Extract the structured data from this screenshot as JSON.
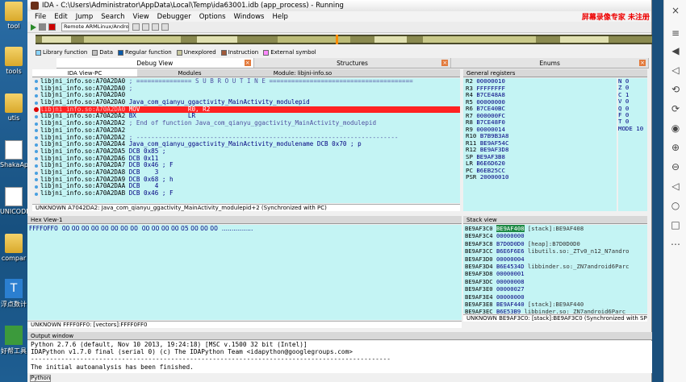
{
  "window": {
    "title": "IDA - C:\\Users\\Administrator\\AppData\\Local\\Temp\\ida63001.idb (app_process) - Running",
    "recorder_badge": "屏幕录像专家 未注册"
  },
  "menu": [
    "File",
    "Edit",
    "Jump",
    "Search",
    "View",
    "Debugger",
    "Options",
    "Windows",
    "Help"
  ],
  "toolbar": {
    "debugger_select": "Remote ARMLinux/Android debugger"
  },
  "legend": [
    {
      "label": "Library function",
      "color": "#8ad4ff"
    },
    {
      "label": "Data",
      "color": "#c0c0c0"
    },
    {
      "label": "Regular function",
      "color": "#0a5aa8"
    },
    {
      "label": "Unexplored",
      "color": "#c8c8a0"
    },
    {
      "label": "Instruction",
      "color": "#a05a3a"
    },
    {
      "label": "External symbol",
      "color": "#ff88ff"
    }
  ],
  "top_tabs": [
    "Debug View",
    "Structures",
    "Enums"
  ],
  "debug_view": {
    "subtabs": [
      "IDA View-PC",
      "Modules",
      "Module: libjni-info.so"
    ],
    "lines": [
      {
        "addr": "libjni_info.so:A70A2DA0",
        "text": " ; =============== S U B R O U T I N E ======================================="
      },
      {
        "addr": "libjni_info.so:A70A2DA0",
        "text": " ;"
      },
      {
        "addr": "libjni_info.so:A70A2DA0",
        "text": ""
      },
      {
        "addr": "libjni_info.so:A70A2DA0",
        "text": " Java_com_qianyu_ggactivity_MainActivity_modulepid"
      },
      {
        "addr": "libjni_info.so:A70A2DA0",
        "text": " MOV             R0, R2",
        "highlight": true
      },
      {
        "addr": "libjni_info.so:A70A2DA2",
        "text": " BX              LR"
      },
      {
        "addr": "libjni_info.so:A70A2DA2",
        "text": " ; End of function Java_com_qianyu_ggactivity_MainActivity_modulepid"
      },
      {
        "addr": "libjni_info.so:A70A2DA2",
        "text": ""
      },
      {
        "addr": "libjni_info.so:A70A2DA2",
        "text": " ; -----------------------------------------------------------------------"
      },
      {
        "addr": "libjni_info.so:A70A2DA4",
        "text": " Java_com_qianyu_ggactivity_MainActivity_modulename DCB 0x70 ; p"
      },
      {
        "addr": "libjni_info.so:A70A2DA5",
        "text": " DCB 0x85 ;"
      },
      {
        "addr": "libjni_info.so:A70A2DA6",
        "text": " DCB 0x11"
      },
      {
        "addr": "libjni_info.so:A70A2DA7",
        "text": " DCB 0x46 ; F"
      },
      {
        "addr": "libjni_info.so:A70A2DA8",
        "text": " DCB    3"
      },
      {
        "addr": "libjni_info.so:A70A2DA9",
        "text": " DCB 0x68 ; h"
      },
      {
        "addr": "libjni_info.so:A70A2DAA",
        "text": " DCB    4"
      },
      {
        "addr": "libjni_info.so:A70A2DAB",
        "text": " DCB 0x46 ; F"
      }
    ],
    "status": "UNKNOWN A7042DA2: Java_com_qianyu_ggactivity_MainActivity_modulepid+2 (Synchronized with PC)"
  },
  "registers": {
    "title": "General registers",
    "rows": [
      {
        "name": "R2",
        "value": "00000010"
      },
      {
        "name": "R3",
        "value": "FFFFFFFF"
      },
      {
        "name": "R4",
        "value": "B7CE48A8"
      },
      {
        "name": "R5",
        "value": "00000000"
      },
      {
        "name": "R6",
        "value": "B7CE40BC"
      },
      {
        "name": "R7",
        "value": "000000FC"
      },
      {
        "name": "R8",
        "value": "B7CE48F0"
      },
      {
        "name": "R9",
        "value": "00000014"
      },
      {
        "name": "R10",
        "value": "B7B9B3A8"
      },
      {
        "name": "R11",
        "value": "BE9AF54C"
      },
      {
        "name": "R12",
        "value": "BE9AF3D8"
      },
      {
        "name": "SP",
        "value": "BE9AF3B8"
      },
      {
        "name": "LR",
        "value": "B6E6D620"
      },
      {
        "name": "PC",
        "value": "B6EB25CC"
      },
      {
        "name": "PSR",
        "value": "20000010"
      }
    ],
    "flags": [
      {
        "name": "N",
        "value": "0"
      },
      {
        "name": "Z",
        "value": "0"
      },
      {
        "name": "C",
        "value": "1"
      },
      {
        "name": "V",
        "value": "0"
      },
      {
        "name": "Q",
        "value": "0"
      },
      {
        "name": "F",
        "value": "0"
      },
      {
        "name": "T",
        "value": "0"
      },
      {
        "name": "MODE",
        "value": "10"
      }
    ]
  },
  "hex_view": {
    "title": "Hex View-1",
    "line": "FFFF0FF0  00 00 00 00 00 00 00 00  00 00 00 00 05 00 00 00  ................",
    "status": "UNKNOWN FFFF0FF0: [vectors]:FFFF0FF0"
  },
  "stack_view": {
    "title": "Stack view",
    "rows": [
      {
        "addr": "BE9AF3C0",
        "value": "BE9AF408",
        "comment": "[stack]:BE9AF408",
        "hl": true
      },
      {
        "addr": "BE9AF3C4",
        "value": "00000000",
        "comment": ""
      },
      {
        "addr": "BE9AF3C8",
        "value": "B7D0D0D0",
        "comment": "[heap]:B7D0D0D0"
      },
      {
        "addr": "BE9AF3CC",
        "value": "B6E6F6E6",
        "comment": "libutils.so:_ZTv0_n12_N7andro"
      },
      {
        "addr": "BE9AF3D0",
        "value": "00000004",
        "comment": ""
      },
      {
        "addr": "BE9AF3D4",
        "value": "B6E4534D",
        "comment": "libbinder.so:_ZN7android6Parc"
      },
      {
        "addr": "BE9AF3D8",
        "value": "00000001",
        "comment": ""
      },
      {
        "addr": "BE9AF3DC",
        "value": "00000008",
        "comment": ""
      },
      {
        "addr": "BE9AF3E0",
        "value": "00000027",
        "comment": ""
      },
      {
        "addr": "BE9AF3E4",
        "value": "00000000",
        "comment": ""
      },
      {
        "addr": "BE9AF3E8",
        "value": "BE9AF440",
        "comment": "[stack]:BE9AF440"
      },
      {
        "addr": "BE9AF3EC",
        "value": "B6E53B9",
        "comment": "libbinder.so:_ZN7android6Parc"
      }
    ],
    "status": "UNKNOWN BE9AF3C0: [stack]:BE9AF3C0 (Synchronized with SP)"
  },
  "output": {
    "title": "Output window",
    "lines": [
      "Python 2.7.6 (default, Nov 10 2013, 19:24:18) [MSC v.1500 32 bit (Intel)]",
      "IDAPython v1.7.0 final (serial 0) (c) The IDAPython Team <idapython@googlegroups.com>",
      "-----------------------------------------------------------------------------------------------",
      "The initial autoanalysis has been finished."
    ],
    "python_button": "Python"
  },
  "desktop_icons": [
    "tool",
    "tools",
    "utis",
    "ShakaApk",
    "UNICODE",
    "compar",
    "浮点数计",
    "好帮工具"
  ]
}
